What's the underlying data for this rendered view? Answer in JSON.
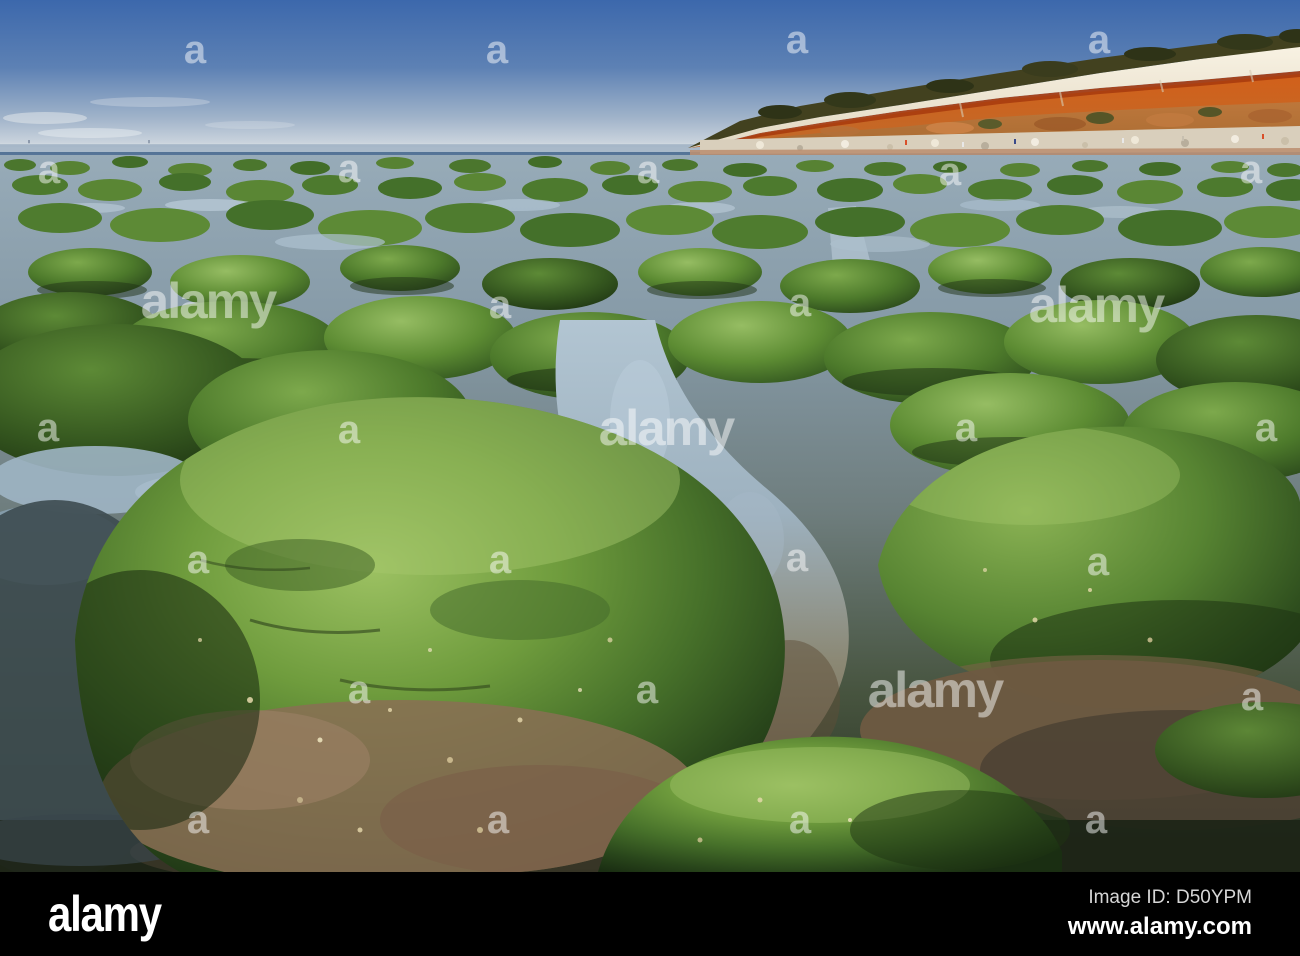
{
  "watermark": {
    "brand": "alamy",
    "tile_letter": "a"
  },
  "footer": {
    "logo": "alamy",
    "image_id": "Image ID: D50YPM",
    "url": "www.alamy.com",
    "background_color": "#000000",
    "logo_color": "#ffffff",
    "id_text_color": "#d6d6d6",
    "url_text_color": "#ffffff"
  },
  "scene_palette": {
    "sky_top": "#3c68ac",
    "sky_horizon": "#d4dbe1",
    "sea": "#53738f",
    "cliff_chalk": "#f4eddd",
    "cliff_carrstone_orange": "#d2621a",
    "cliff_red_streak": "#a83c0e",
    "algae_sunlit": "#8cb457",
    "algae_shadow": "#1e3314",
    "tidal_pool_blue": "#9db4c4",
    "tidal_pool_brown": "#6e5a41"
  }
}
